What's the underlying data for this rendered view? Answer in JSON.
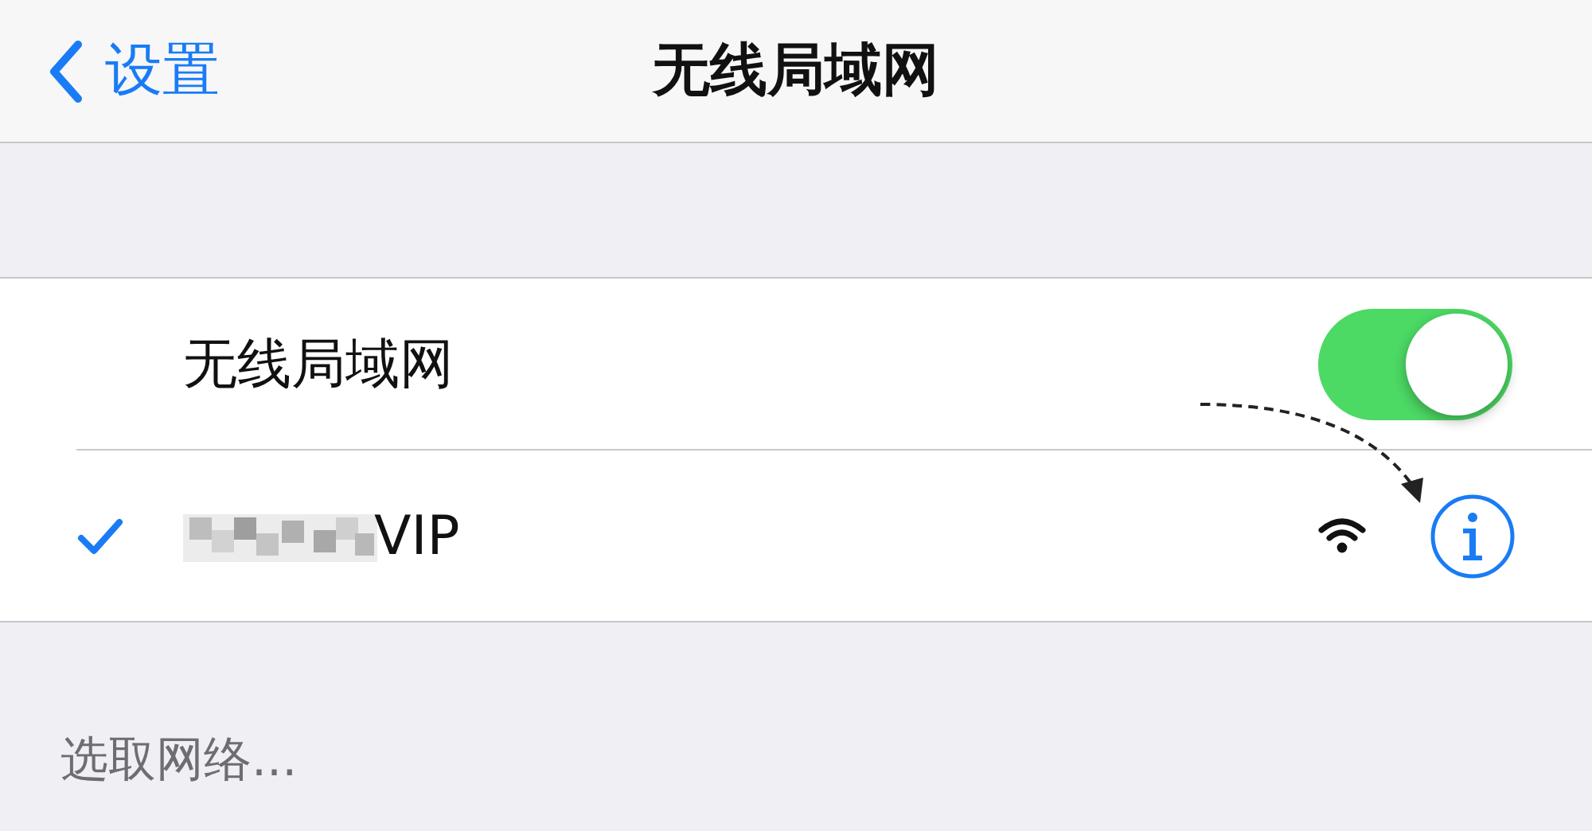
{
  "nav_bar": {
    "back_label": "设置",
    "title": "无线局域网"
  },
  "wifi_switch": {
    "label": "无线局域网",
    "on": true
  },
  "networks": [
    {
      "name": "VIP",
      "selected": true
    }
  ],
  "section_header": "选取网络..."
}
